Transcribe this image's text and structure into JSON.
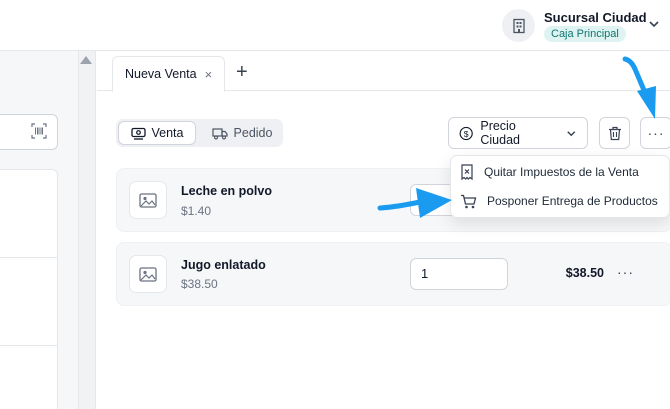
{
  "header": {
    "branch_name": "Sucursal Ciudad",
    "branch_badge": "Caja Principal"
  },
  "tabs": {
    "active_label": "Nueva Venta",
    "close_symbol": "×",
    "add_symbol": "+"
  },
  "mode_toggle": {
    "venta_label": "Venta",
    "pedido_label": "Pedido",
    "selected": "Venta"
  },
  "toolbar": {
    "price_list_label": "Precio Ciudad",
    "more_label": "···"
  },
  "menu": {
    "items": [
      {
        "label": "Quitar Impuestos de la Venta",
        "icon": "receipt-x-icon"
      },
      {
        "label": "Posponer Entrega de Productos",
        "icon": "cart-icon"
      }
    ]
  },
  "cart": {
    "items": [
      {
        "name": "Leche en polvo",
        "price": "$1.40",
        "quantity": "",
        "total": "",
        "more": "···"
      },
      {
        "name": "Jugo enlatado",
        "price": "$38.50",
        "quantity": "1",
        "total": "$38.50",
        "more": "···"
      }
    ]
  },
  "colors": {
    "accent_arrow": "#1a9bf0",
    "badge_bg": "#dff3f3",
    "badge_text": "#0f766e"
  }
}
